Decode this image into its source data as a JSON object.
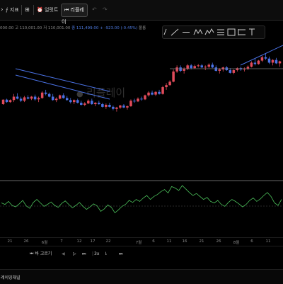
{
  "toolbar": {
    "indicators_label": "지표",
    "alert_label": "얼럿트",
    "replay_label": "리플레이",
    "undo_icon": "undo-icon",
    "redo_icon": "redo-icon"
  },
  "legend": {
    "open": "000.00",
    "high": "고 110,001.00",
    "low": "저 110,001.00",
    "close": "종 111,499.00 +",
    "change": "-923.00 (-0.45%)",
    "volume": "볼륨"
  },
  "watermark": "리플레이",
  "x_axis": {
    "ticks": [
      "21",
      "26",
      "6월",
      "7",
      "12",
      "17",
      "22",
      "7월",
      "6",
      "11",
      "16",
      "21",
      "26",
      "8월",
      "6",
      "11"
    ]
  },
  "player": {
    "back_label": "바 고르기",
    "speed_label": "3x"
  },
  "footer": {
    "label": "레이밍채널"
  },
  "chart_data": [
    {
      "type": "candlestick",
      "up_color": "#e14b5a",
      "down_color": "#4a72e6",
      "candles": [
        [
          0.505,
          0.54,
          0.5,
          0.538
        ],
        [
          0.538,
          0.545,
          0.515,
          0.52
        ],
        [
          0.52,
          0.54,
          0.515,
          0.535
        ],
        [
          0.535,
          0.58,
          0.52,
          0.56
        ],
        [
          0.56,
          0.585,
          0.54,
          0.545
        ],
        [
          0.545,
          0.56,
          0.52,
          0.53
        ],
        [
          0.53,
          0.565,
          0.52,
          0.555
        ],
        [
          0.555,
          0.57,
          0.54,
          0.545
        ],
        [
          0.545,
          0.565,
          0.535,
          0.56
        ],
        [
          0.56,
          0.575,
          0.53,
          0.54
        ],
        [
          0.54,
          0.56,
          0.52,
          0.55
        ],
        [
          0.55,
          0.6,
          0.545,
          0.59
        ],
        [
          0.59,
          0.61,
          0.57,
          0.58
        ],
        [
          0.58,
          0.59,
          0.555,
          0.56
        ],
        [
          0.56,
          0.58,
          0.53,
          0.535
        ],
        [
          0.535,
          0.555,
          0.52,
          0.545
        ],
        [
          0.545,
          0.575,
          0.54,
          0.57
        ],
        [
          0.57,
          0.585,
          0.545,
          0.55
        ],
        [
          0.55,
          0.565,
          0.53,
          0.535
        ],
        [
          0.535,
          0.55,
          0.51,
          0.52
        ],
        [
          0.52,
          0.54,
          0.505,
          0.535
        ],
        [
          0.535,
          0.545,
          0.51,
          0.515
        ],
        [
          0.515,
          0.53,
          0.495,
          0.5
        ],
        [
          0.5,
          0.52,
          0.49,
          0.51
        ],
        [
          0.51,
          0.54,
          0.505,
          0.53
        ],
        [
          0.53,
          0.545,
          0.5,
          0.505
        ],
        [
          0.505,
          0.52,
          0.49,
          0.515
        ],
        [
          0.515,
          0.53,
          0.5,
          0.505
        ],
        [
          0.505,
          0.515,
          0.48,
          0.485
        ],
        [
          0.485,
          0.51,
          0.47,
          0.5
        ],
        [
          0.5,
          0.515,
          0.48,
          0.485
        ],
        [
          0.485,
          0.495,
          0.46,
          0.47
        ],
        [
          0.47,
          0.485,
          0.45,
          0.48
        ],
        [
          0.48,
          0.5,
          0.47,
          0.495
        ],
        [
          0.495,
          0.505,
          0.475,
          0.48
        ],
        [
          0.48,
          0.495,
          0.465,
          0.49
        ],
        [
          0.49,
          0.54,
          0.485,
          0.53
        ],
        [
          0.53,
          0.545,
          0.515,
          0.525
        ],
        [
          0.525,
          0.555,
          0.52,
          0.545
        ],
        [
          0.545,
          0.56,
          0.53,
          0.54
        ],
        [
          0.54,
          0.575,
          0.535,
          0.57
        ],
        [
          0.57,
          0.6,
          0.56,
          0.59
        ],
        [
          0.59,
          0.605,
          0.57,
          0.575
        ],
        [
          0.575,
          0.6,
          0.565,
          0.595
        ],
        [
          0.595,
          0.61,
          0.575,
          0.58
        ],
        [
          0.58,
          0.64,
          0.575,
          0.63
        ],
        [
          0.63,
          0.66,
          0.61,
          0.645
        ],
        [
          0.645,
          0.68,
          0.64,
          0.67
        ],
        [
          0.67,
          0.76,
          0.665,
          0.745
        ],
        [
          0.745,
          0.79,
          0.735,
          0.775
        ],
        [
          0.775,
          0.79,
          0.74,
          0.75
        ],
        [
          0.75,
          0.775,
          0.73,
          0.765
        ],
        [
          0.765,
          0.8,
          0.755,
          0.79
        ],
        [
          0.79,
          0.8,
          0.76,
          0.77
        ],
        [
          0.77,
          0.795,
          0.765,
          0.785
        ],
        [
          0.785,
          0.8,
          0.775,
          0.79
        ],
        [
          0.79,
          0.8,
          0.77,
          0.775
        ],
        [
          0.775,
          0.79,
          0.755,
          0.78
        ],
        [
          0.78,
          0.805,
          0.77,
          0.795
        ],
        [
          0.795,
          0.81,
          0.77,
          0.775
        ],
        [
          0.775,
          0.79,
          0.745,
          0.75
        ],
        [
          0.75,
          0.77,
          0.73,
          0.76
        ],
        [
          0.76,
          0.78,
          0.745,
          0.775
        ],
        [
          0.775,
          0.785,
          0.75,
          0.755
        ],
        [
          0.755,
          0.77,
          0.73,
          0.735
        ],
        [
          0.735,
          0.76,
          0.725,
          0.755
        ],
        [
          0.755,
          0.775,
          0.745,
          0.77
        ],
        [
          0.77,
          0.78,
          0.75,
          0.76
        ],
        [
          0.76,
          0.775,
          0.745,
          0.765
        ],
        [
          0.765,
          0.79,
          0.755,
          0.78
        ],
        [
          0.78,
          0.82,
          0.775,
          0.81
        ],
        [
          0.81,
          0.84,
          0.79,
          0.8
        ],
        [
          0.8,
          0.83,
          0.795,
          0.825
        ],
        [
          0.825,
          0.86,
          0.815,
          0.85
        ],
        [
          0.85,
          0.88,
          0.83,
          0.84
        ],
        [
          0.84,
          0.855,
          0.8,
          0.81
        ],
        [
          0.81,
          0.835,
          0.79,
          0.83
        ],
        [
          0.83,
          0.845,
          0.8,
          0.805
        ],
        [
          0.805,
          0.825,
          0.78,
          0.82
        ]
      ]
    },
    {
      "type": "line",
      "name": "",
      "values": [
        0.55,
        0.52,
        0.58,
        0.5,
        0.47,
        0.53,
        0.6,
        0.49,
        0.44,
        0.56,
        0.62,
        0.55,
        0.48,
        0.52,
        0.57,
        0.5,
        0.46,
        0.54,
        0.59,
        0.52,
        0.45,
        0.5,
        0.56,
        0.48,
        0.42,
        0.47,
        0.53,
        0.49,
        0.38,
        0.43,
        0.51,
        0.46,
        0.35,
        0.41,
        0.48,
        0.52,
        0.6,
        0.56,
        0.62,
        0.58,
        0.65,
        0.7,
        0.62,
        0.68,
        0.72,
        0.78,
        0.82,
        0.75,
        0.88,
        0.85,
        0.8,
        0.9,
        0.83,
        0.76,
        0.7,
        0.74,
        0.68,
        0.62,
        0.66,
        0.58,
        0.55,
        0.6,
        0.52,
        0.48,
        0.56,
        0.62,
        0.58,
        0.53,
        0.47,
        0.52,
        0.6,
        0.65,
        0.58,
        0.63,
        0.7,
        0.76,
        0.68,
        0.55,
        0.5,
        0.62
      ]
    }
  ]
}
